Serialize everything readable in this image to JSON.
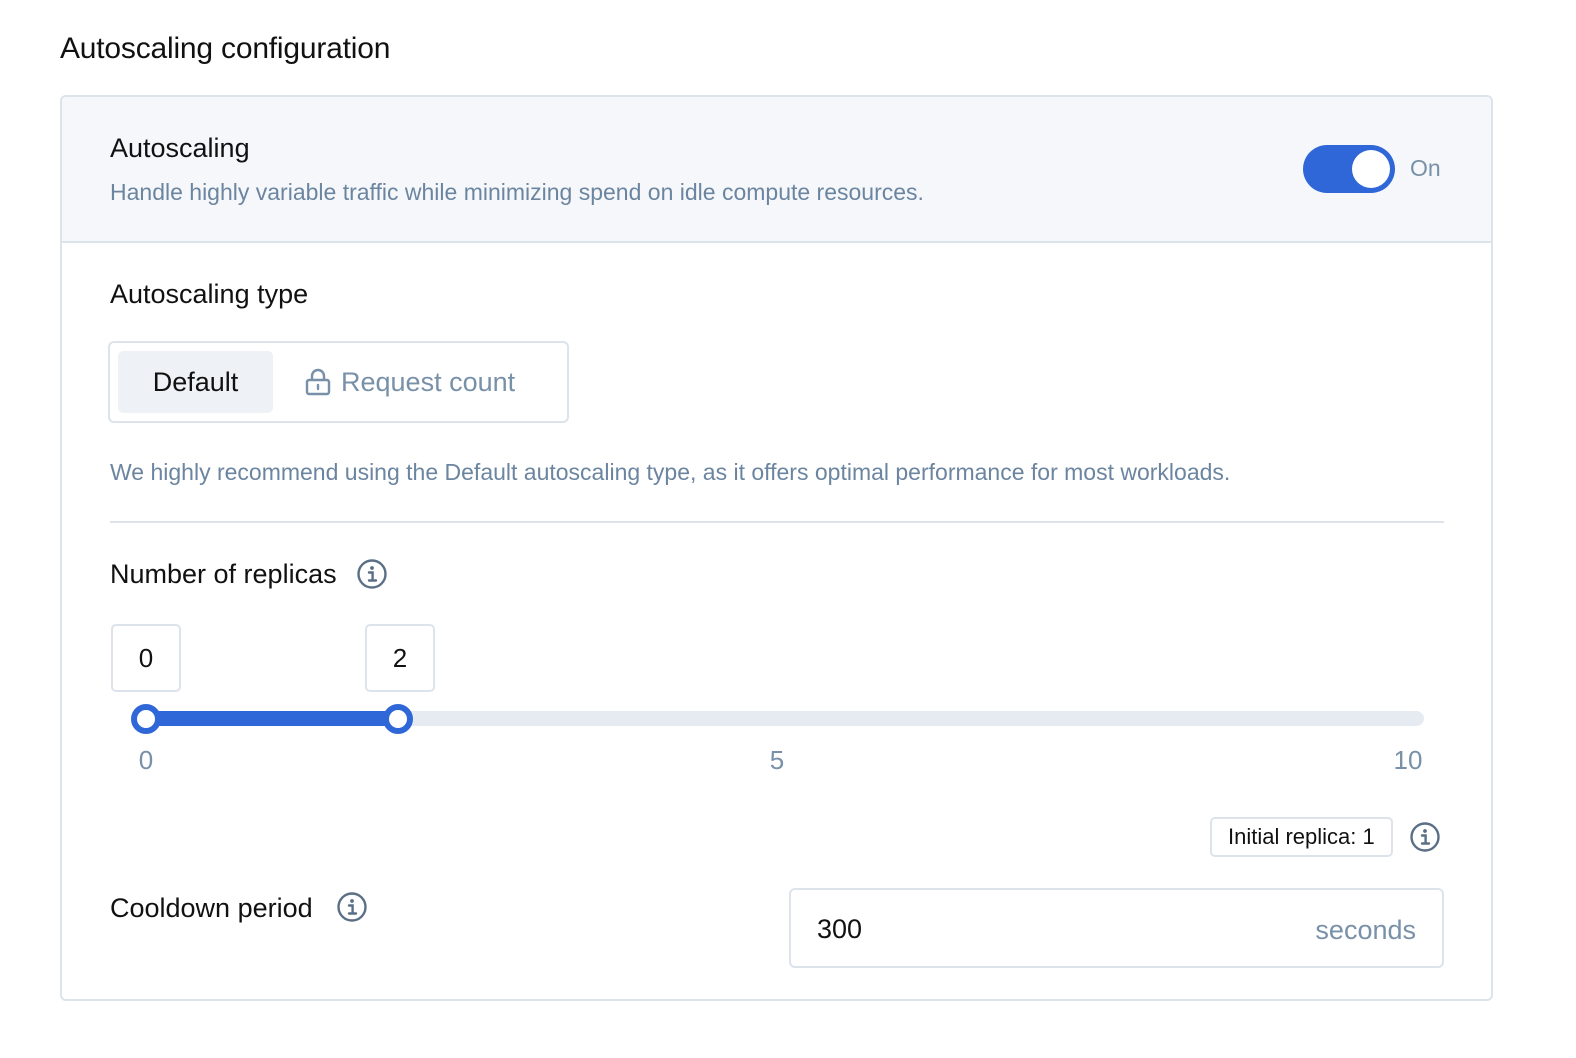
{
  "page": {
    "title": "Autoscaling configuration"
  },
  "autoscaling": {
    "title": "Autoscaling",
    "description": "Handle highly variable traffic while minimizing spend on idle compute resources.",
    "enabled": true,
    "toggle_label": "On",
    "accent_color": "#2f67d8"
  },
  "autoscaling_type": {
    "title": "Autoscaling type",
    "options": [
      {
        "label": "Default",
        "selected": true,
        "locked": false
      },
      {
        "label": "Request count",
        "selected": false,
        "locked": true,
        "icon": "lock-icon"
      }
    ],
    "recommendation": "We highly recommend using the Default autoscaling type, as it offers optimal performance for most workloads."
  },
  "replicas": {
    "title": "Number of replicas",
    "min_value": "0",
    "max_value": "2",
    "range_min": 0,
    "range_max": 10,
    "ticks": [
      "0",
      "5",
      "10"
    ],
    "initial_replica_label": "Initial replica: 1"
  },
  "cooldown": {
    "title": "Cooldown period",
    "value": "300",
    "unit": "seconds"
  }
}
